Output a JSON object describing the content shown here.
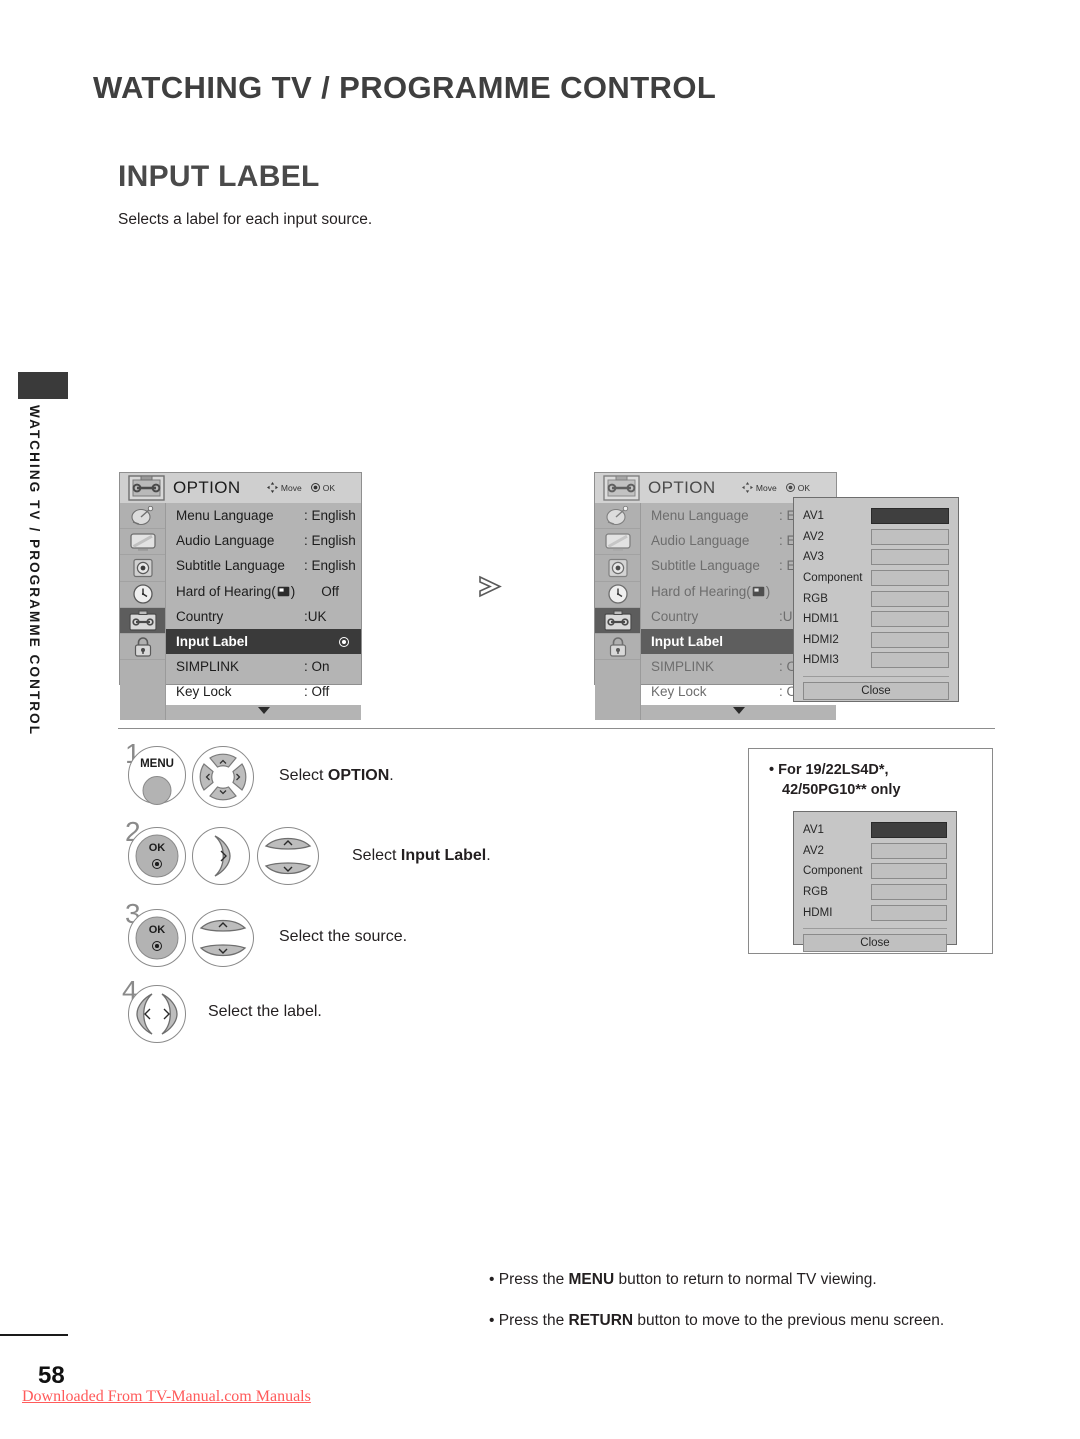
{
  "chapter_title": "WATCHING TV / PROGRAMME CONTROL",
  "section_title": "INPUT LABEL",
  "section_desc": "Selects a label for each input source.",
  "side_tab": {
    "label": "WATCHING TV / PROGRAMME CONTROL"
  },
  "osd": {
    "title": "OPTION",
    "hint_move": "Move",
    "hint_ok": "OK",
    "icons": [
      "satellite-dish-icon",
      "tv-picture-icon",
      "speaker-audio-icon",
      "clock-time-icon",
      "toolbox-option-icon",
      "lock-padlock-icon"
    ],
    "header_icon": "toolbox-option-icon",
    "rows": [
      {
        "label": "Menu Language",
        "value": ": English",
        "selected": false
      },
      {
        "label": "Audio Language",
        "value": ": English",
        "selected": false
      },
      {
        "label": "Subtitle Language",
        "value": ": English",
        "selected": false
      },
      {
        "label": "Hard of Hearing(",
        "value": "Off",
        "selected": false,
        "cc_icon": true,
        "label_tail": ")"
      },
      {
        "label": "Country",
        "value": ":UK",
        "selected": false
      },
      {
        "label": "Input Label",
        "value": "",
        "selected": true
      },
      {
        "label": "SIMPLINK",
        "value": ": On",
        "selected": false
      },
      {
        "label": "Key Lock",
        "value": ": Off",
        "selected": false
      }
    ]
  },
  "flow_arrow": "chevron-right-icon",
  "input_list_full": {
    "items": [
      "AV1",
      "AV2",
      "AV3",
      "Component",
      "RGB",
      "HDMI1",
      "HDMI2",
      "HDMI3"
    ],
    "active_index": 0,
    "close_label": "Close"
  },
  "input_list_small": {
    "items": [
      "AV1",
      "AV2",
      "Component",
      "RGB",
      "HDMI"
    ],
    "active_index": 0,
    "close_label": "Close"
  },
  "steps": [
    {
      "num": "1",
      "text_plain": "Select ",
      "text_bold": "OPTION",
      "text_tail": "."
    },
    {
      "num": "2",
      "text_plain": "Select ",
      "text_bold": "Input Label",
      "text_tail": "."
    },
    {
      "num": "3",
      "text_plain": "Select the source.",
      "text_bold": "",
      "text_tail": ""
    },
    {
      "num": "4",
      "text_plain": "Select the label.",
      "text_bold": "",
      "text_tail": ""
    }
  ],
  "buttons": {
    "menu_label": "MENU",
    "ok_label": "OK"
  },
  "model_note": {
    "line1": "• For 19/22LS4D",
    "line1_sup": "*",
    "line1_end": ",",
    "line2": "42/50PG10",
    "line2_sup": "**",
    "line2_end": " only"
  },
  "footnotes": [
    {
      "pre": "• Press the ",
      "bold": "MENU",
      "post": " button to return to normal TV viewing."
    },
    {
      "pre": "• Press the ",
      "bold": "RETURN",
      "post": " button to move to the previous menu screen."
    }
  ],
  "page_number": "58",
  "download_note": "Downloaded From TV-Manual.com Manuals",
  "colors": {
    "osd_bg": "#b4b4b4",
    "osd_head": "#cfcfcf",
    "selected_row": "#3a3a3a",
    "accent_red": "#ff5a5a"
  }
}
